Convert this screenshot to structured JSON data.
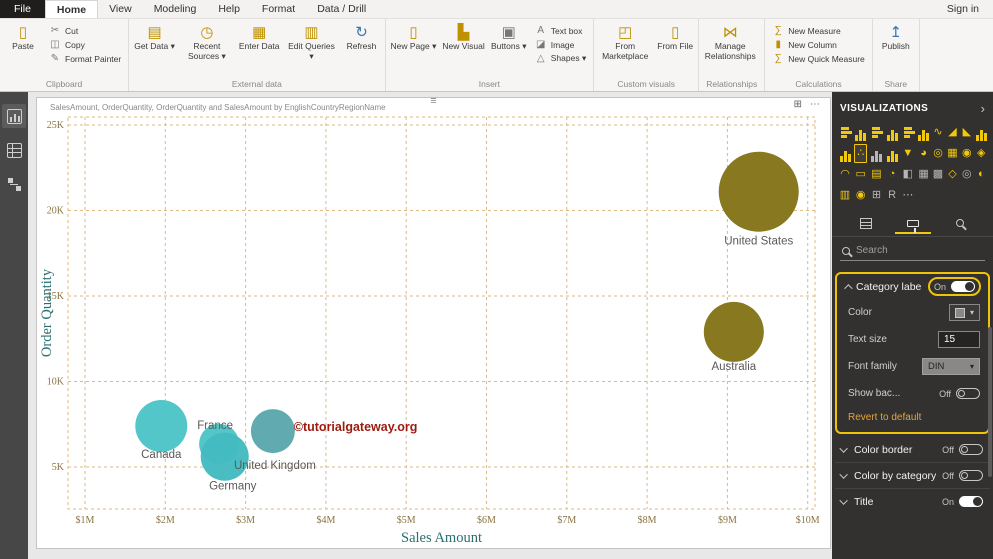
{
  "titlebar": {
    "tabs": [
      {
        "label": "File",
        "style": "dark"
      },
      {
        "label": "Home",
        "style": "active"
      },
      {
        "label": "View"
      },
      {
        "label": "Modeling"
      },
      {
        "label": "Help"
      },
      {
        "label": "Format"
      },
      {
        "label": "Data / Drill"
      }
    ],
    "sign_in": "Sign in"
  },
  "icons": {
    "caret": "▾",
    "drag_handle": "≡",
    "more_options": "⋯",
    "focus_mode": "⊞",
    "collapse_pane": "›"
  },
  "ribbon": {
    "groups": [
      {
        "label": "Clipboard",
        "items": [
          {
            "label": "Paste",
            "icon": "▯",
            "size": "big"
          },
          {
            "label": "Cut",
            "icon": "✂",
            "size": "small",
            "color": "gray"
          },
          {
            "label": "Copy",
            "icon": "◫",
            "size": "small",
            "color": "gray"
          },
          {
            "label": "Format Painter",
            "icon": "✎",
            "size": "small",
            "color": "gray"
          }
        ]
      },
      {
        "label": "External data",
        "items": [
          {
            "label": "Get Data",
            "icon": "▤",
            "size": "big",
            "caret": true
          },
          {
            "label": "Recent Sources",
            "icon": "◷",
            "size": "big",
            "caret": true
          },
          {
            "label": "Enter Data",
            "icon": "▦",
            "size": "big"
          },
          {
            "label": "Edit Queries",
            "icon": "▥",
            "size": "big",
            "caret": true
          },
          {
            "label": "Refresh",
            "icon": "↻",
            "size": "big",
            "color": "blue"
          }
        ]
      },
      {
        "label": "Insert",
        "items": [
          {
            "label": "New Page",
            "icon": "▯",
            "size": "big",
            "caret": true
          },
          {
            "label": "New Visual",
            "icon": "▙",
            "size": "big"
          },
          {
            "label": "Buttons",
            "icon": "▣",
            "size": "big",
            "caret": true,
            "color": "gray"
          },
          {
            "label": "Text box",
            "icon": "A",
            "size": "small",
            "color": "gray"
          },
          {
            "label": "Image",
            "icon": "◪",
            "size": "small",
            "color": "gray"
          },
          {
            "label": "Shapes",
            "icon": "△",
            "size": "small",
            "caret": true,
            "color": "gray"
          }
        ]
      },
      {
        "label": "Custom visuals",
        "items": [
          {
            "label": "From Marketplace",
            "icon": "◰",
            "size": "big"
          },
          {
            "label": "From File",
            "icon": "▯",
            "size": "big"
          }
        ]
      },
      {
        "label": "Relationships",
        "items": [
          {
            "label": "Manage Relationships",
            "icon": "⋈",
            "size": "big"
          }
        ]
      },
      {
        "label": "Calculations",
        "items": [
          {
            "label": "New Measure",
            "icon": "∑",
            "size": "small"
          },
          {
            "label": "New Column",
            "icon": "▮",
            "size": "small"
          },
          {
            "label": "New Quick Measure",
            "icon": "∑",
            "size": "small"
          }
        ]
      },
      {
        "label": "Share",
        "items": [
          {
            "label": "Publish",
            "icon": "↥",
            "size": "big",
            "color": "blue"
          }
        ]
      }
    ]
  },
  "viz_pane": {
    "title": "VISUALIZATIONS",
    "search_placeholder": "Search",
    "gallery": [
      {
        "name": "stacked-bar-chart-icon",
        "kind": "hbars"
      },
      {
        "name": "stacked-column-chart-icon",
        "kind": "bars"
      },
      {
        "name": "clustered-bar-chart-icon",
        "kind": "hbars"
      },
      {
        "name": "clustered-column-chart-icon",
        "kind": "bars"
      },
      {
        "name": "100-stacked-bar-chart-icon",
        "kind": "hbars"
      },
      {
        "name": "100-stacked-column-chart-icon",
        "kind": "bars"
      },
      {
        "name": "line-chart-icon",
        "glyph": "∿"
      },
      {
        "name": "area-chart-icon",
        "glyph": "◢"
      },
      {
        "name": "stacked-area-chart-icon",
        "glyph": "◣"
      },
      {
        "name": "line-and-stacked-column-chart-icon",
        "kind": "bars"
      },
      {
        "name": "line-and-clustered-column-chart-icon",
        "kind": "bars"
      },
      {
        "name": "scatter-chart-icon",
        "glyph": "∴",
        "selected": true
      },
      {
        "name": "ribbon-chart-icon",
        "kind": "bars",
        "gray": true
      },
      {
        "name": "waterfall-chart-icon",
        "kind": "bars"
      },
      {
        "name": "funnel-chart-icon",
        "glyph": "▼"
      },
      {
        "name": "pie-chart-icon",
        "glyph": "◕"
      },
      {
        "name": "donut-chart-icon",
        "glyph": "◎"
      },
      {
        "name": "treemap-icon",
        "glyph": "▦"
      },
      {
        "name": "map-icon",
        "glyph": "◉"
      },
      {
        "name": "filled-map-icon",
        "glyph": "◈"
      },
      {
        "name": "gauge-icon",
        "glyph": "◠"
      },
      {
        "name": "card-icon",
        "glyph": "▭"
      },
      {
        "name": "multi-row-card-icon",
        "glyph": "▤"
      },
      {
        "name": "kpi-icon",
        "glyph": "◔"
      },
      {
        "name": "slicer-icon",
        "glyph": "◧",
        "gray": true
      },
      {
        "name": "table-icon",
        "glyph": "▦",
        "gray": true
      },
      {
        "name": "matrix-icon",
        "glyph": "▩",
        "gray": true
      },
      {
        "name": "shape-map-icon",
        "glyph": "◇"
      },
      {
        "name": "arcgis-map-icon",
        "glyph": "◎",
        "gray": true
      },
      {
        "name": "key-influencers-icon",
        "glyph": "◐"
      },
      {
        "name": "table-heatmap-icon",
        "glyph": "▥"
      },
      {
        "name": "esri-map-icon",
        "glyph": "◉"
      },
      {
        "name": "powerapps-icon",
        "glyph": "⊞",
        "gray": true
      },
      {
        "name": "r-script-visual-icon",
        "glyph": "R",
        "gray": true
      },
      {
        "name": "more-visuals-icon",
        "glyph": "⋯",
        "gray": true
      }
    ],
    "sections": [
      {
        "label": "Category labels",
        "state": "On",
        "expanded": true,
        "highlight": true,
        "toggle_highlight": true,
        "fields": [
          {
            "label": "Color",
            "type": "color"
          },
          {
            "label": "Text size",
            "type": "number",
            "value": "15"
          },
          {
            "label": "Font family",
            "type": "dropdown",
            "value": "DIN"
          },
          {
            "label": "Show bac...",
            "type": "toggle",
            "state": "Off"
          }
        ],
        "revert": "Revert to default"
      },
      {
        "label": "Color border",
        "state": "Off"
      },
      {
        "label": "Color by category",
        "state": "Off"
      },
      {
        "label": "Title",
        "state": "On"
      }
    ]
  },
  "chart_data": {
    "type": "scatter",
    "title": "SalesAmount, OrderQuantity, OrderQuantity and SalesAmount by EnglishCountryRegionName",
    "xlabel": "Sales Amount",
    "ylabel": "Order Quantity",
    "x_ticks": [
      "$1M",
      "$2M",
      "$3M",
      "$4M",
      "$5M",
      "$6M",
      "$7M",
      "$8M",
      "$9M",
      "$10M"
    ],
    "x_tick_values": [
      1,
      2,
      3,
      4,
      5,
      6,
      7,
      8,
      9,
      10
    ],
    "y_ticks": [
      "5K",
      "10K",
      "15K",
      "20K",
      "25K"
    ],
    "y_tick_values": [
      5,
      10,
      15,
      20,
      25
    ],
    "x_unit": "millions USD",
    "y_unit": "thousands of units",
    "grid": "dashed",
    "grid_color": "#ddba85",
    "legend": "none",
    "points": [
      {
        "label": "France",
        "x_millions": 2.67,
        "y_thousands": 6.35,
        "r": 20,
        "color": "#4bc4c6",
        "label_dx": -4,
        "label_dy": -15
      },
      {
        "label": "Germany",
        "x_millions": 2.74,
        "y_thousands": 5.6,
        "r": 24,
        "color": "#43bac0",
        "label_dx": 8,
        "label_dy": 33
      },
      {
        "label": "Canada",
        "x_millions": 1.95,
        "y_thousands": 7.4,
        "r": 26,
        "color": "#4bc4c6",
        "label_dx": 0,
        "label_dy": 32
      },
      {
        "label": "United Kingdom",
        "x_millions": 3.34,
        "y_thousands": 7.1,
        "r": 22,
        "color": "#5ba8ad",
        "label_dx": 2,
        "label_dy": 38
      },
      {
        "label": "Australia",
        "x_millions": 9.08,
        "y_thousands": 12.9,
        "r": 30,
        "color": "#837317",
        "label_dx": 0,
        "label_dy": 38
      },
      {
        "label": "United States",
        "x_millions": 9.39,
        "y_thousands": 21.1,
        "r": 40,
        "color": "#837317",
        "label_dx": 0,
        "label_dy": 53
      }
    ],
    "watermark": {
      "text": "©tutorialgateway.org",
      "x_millions": 3.6,
      "y_thousands": 7.1,
      "color": "#9b1b10"
    }
  }
}
